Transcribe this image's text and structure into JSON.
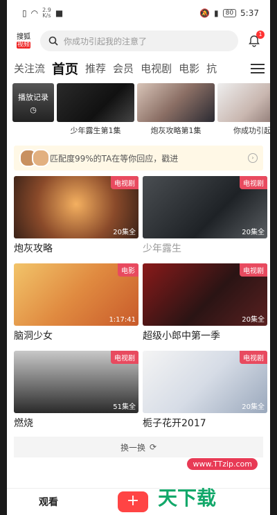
{
  "status_bar": {
    "net_speed": "2.9",
    "net_unit": "K/s",
    "battery": "80",
    "time": "5:37"
  },
  "header": {
    "logo_top": "搜狐",
    "logo_bottom": "视频",
    "search_placeholder": "你成功引起我的注意了",
    "notification_count": "1"
  },
  "tabs": [
    "关注流",
    "首页",
    "推荐",
    "会员",
    "电视剧",
    "电影",
    "抗"
  ],
  "history": {
    "record_label": "播放记录",
    "items": [
      {
        "title": "少年露生第1集"
      },
      {
        "title": "炮灰攻略第1集"
      },
      {
        "title": "你成功引起我"
      }
    ]
  },
  "match_banner": {
    "text": "匹配度99%的TA在等你回应，戳进"
  },
  "cards": [
    {
      "title": "炮灰攻略",
      "tag": "电视剧",
      "count": "20集全"
    },
    {
      "title": "少年露生",
      "tag": "电视剧",
      "count": "20集全"
    },
    {
      "title": "脑洞少女",
      "tag": "电影",
      "count": "1:17:41"
    },
    {
      "title": "超级小郎中第一季",
      "tag": "电视剧",
      "count": "20集全"
    },
    {
      "title": "燃烧",
      "tag": "电视剧",
      "count": "51集全"
    },
    {
      "title": "栀子花开2017",
      "tag": "电视剧",
      "count": "20集全"
    }
  ],
  "refresh_label": "换一换",
  "bottom_bar": {
    "watch_label": "观看",
    "plus_label": "+"
  },
  "watermark": {
    "url": "www.TTzip.com",
    "text": "天下载"
  }
}
